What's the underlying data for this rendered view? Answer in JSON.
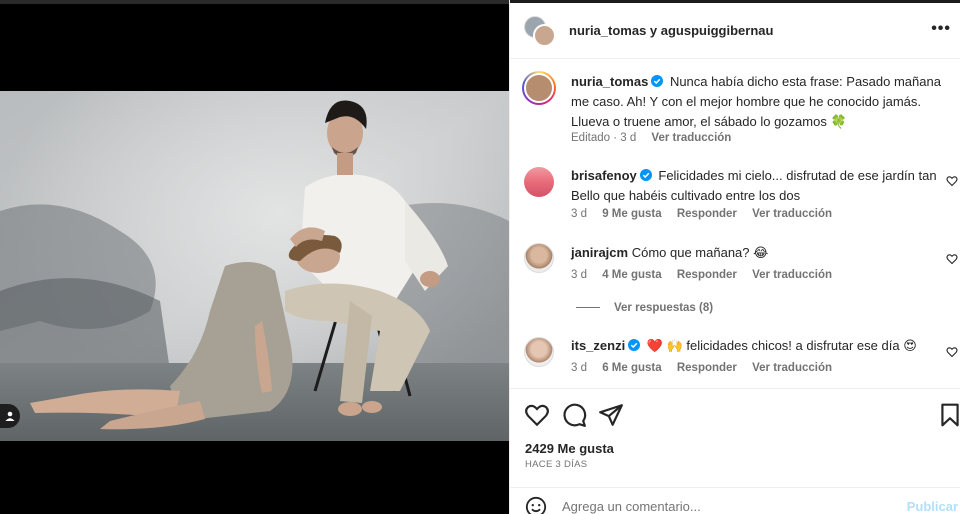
{
  "post": {
    "header_names": "nuria_tomas y aguspuiggibernau",
    "caption": {
      "username": "nuria_tomas",
      "text": "Nunca había dicho esta frase: Pasado mañana me caso. Ah! Y con el mejor hombre que he conocido jamás. Llueva o truene amor, el sábado lo gozamos",
      "emoji": "🍀",
      "edited": "Editado · 3 d",
      "translate": "Ver traducción"
    },
    "comments": [
      {
        "username": "brisafenoy",
        "text": "Felicidades mi cielo... disfrutad de ese jardín tan Bello que habéis cultivado entre los dos",
        "time": "3 d",
        "likes": "9 Me gusta",
        "reply": "Responder",
        "translate": "Ver traducción"
      },
      {
        "username": "janirajcm",
        "text": "Cómo que mañana? 😂",
        "time": "3 d",
        "likes": "4 Me gusta",
        "reply": "Responder",
        "translate": "Ver traducción",
        "view_replies": "Ver respuestas (8)"
      },
      {
        "username": "its_zenzi",
        "text": "❤️ 🙌 felicidades chicos! a disfrutar ese día 😍",
        "time": "3 d",
        "likes": "6 Me gusta",
        "reply": "Responder",
        "translate": "Ver traducción"
      }
    ],
    "likes": "2429 Me gusta",
    "posted_ago": "HACE 3 DÍAS",
    "comment_placeholder": "Agrega un comentario...",
    "publish_label": "Publicar"
  },
  "colors": {
    "verified": "#0095f6",
    "publish_disabled": "#b2dffc",
    "secondary_text": "#737373"
  },
  "icons": [
    "more-icon",
    "heart-icon",
    "comment-icon",
    "share-icon",
    "save-icon",
    "emoji-icon",
    "user-tag-icon",
    "verified-icon"
  ]
}
